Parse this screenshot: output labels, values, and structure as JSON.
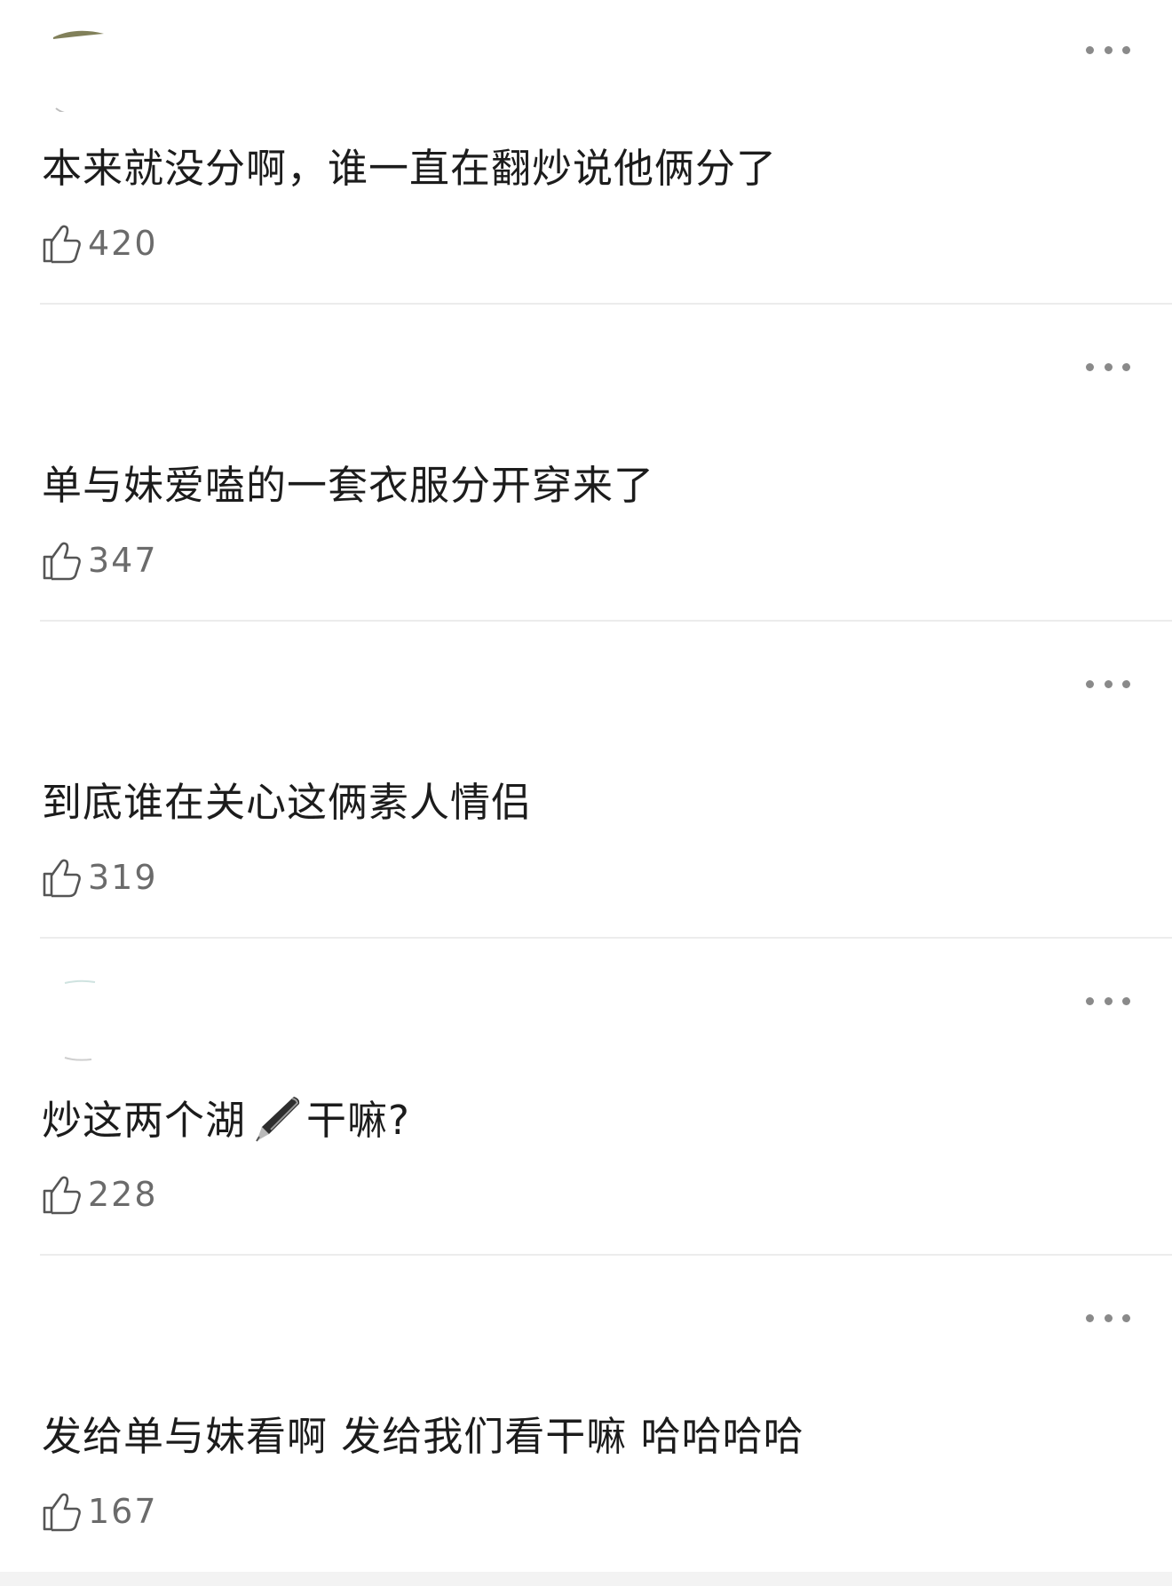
{
  "comments": [
    {
      "text": "本来就没分啊，谁一直在翻炒说他俩分了",
      "likes": "420"
    },
    {
      "text": "单与妹爱嗑的一套衣服分开穿来了",
      "likes": "347"
    },
    {
      "text": "到底谁在关心这俩素人情侣",
      "likes": "319"
    },
    {
      "text_before": "炒这两个湖",
      "text_after": "干嘛?",
      "emoji": "pen-emoji",
      "likes": "228"
    },
    {
      "text": "发给单与妹看啊 发给我们看干嘛 哈哈哈哈",
      "likes": "167"
    }
  ],
  "icons": {
    "like": "thumbs-up-icon",
    "more": "more-dots-icon"
  },
  "colors": {
    "text": "#1c1c1c",
    "meta": "#6b6b6b",
    "divider": "#ececec",
    "dots": "#8a8a8a"
  }
}
